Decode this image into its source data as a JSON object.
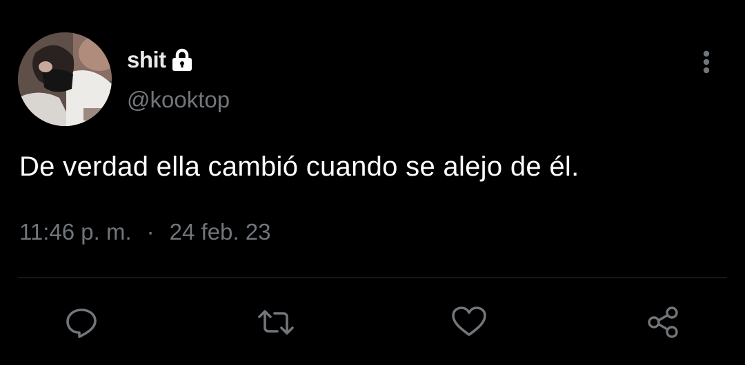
{
  "author": {
    "display_name": "shit",
    "handle": "@kooktop",
    "protected_icon": "lock-icon",
    "avatar_icon": "avatar-photo"
  },
  "tweet": {
    "text": "De verdad ella cambió cuando se alejo de él.",
    "time": "11:46 p. m.",
    "separator": "·",
    "date": "24 feb. 23"
  },
  "actions": {
    "reply_icon": "reply-icon",
    "retweet_icon": "retweet-icon",
    "like_icon": "heart-icon",
    "share_icon": "share-icon",
    "more_icon": "more-vertical-icon"
  },
  "colors": {
    "background": "#000000",
    "text_primary": "#e7e9ea",
    "text_secondary": "#71767b",
    "divider": "#2f3336"
  }
}
